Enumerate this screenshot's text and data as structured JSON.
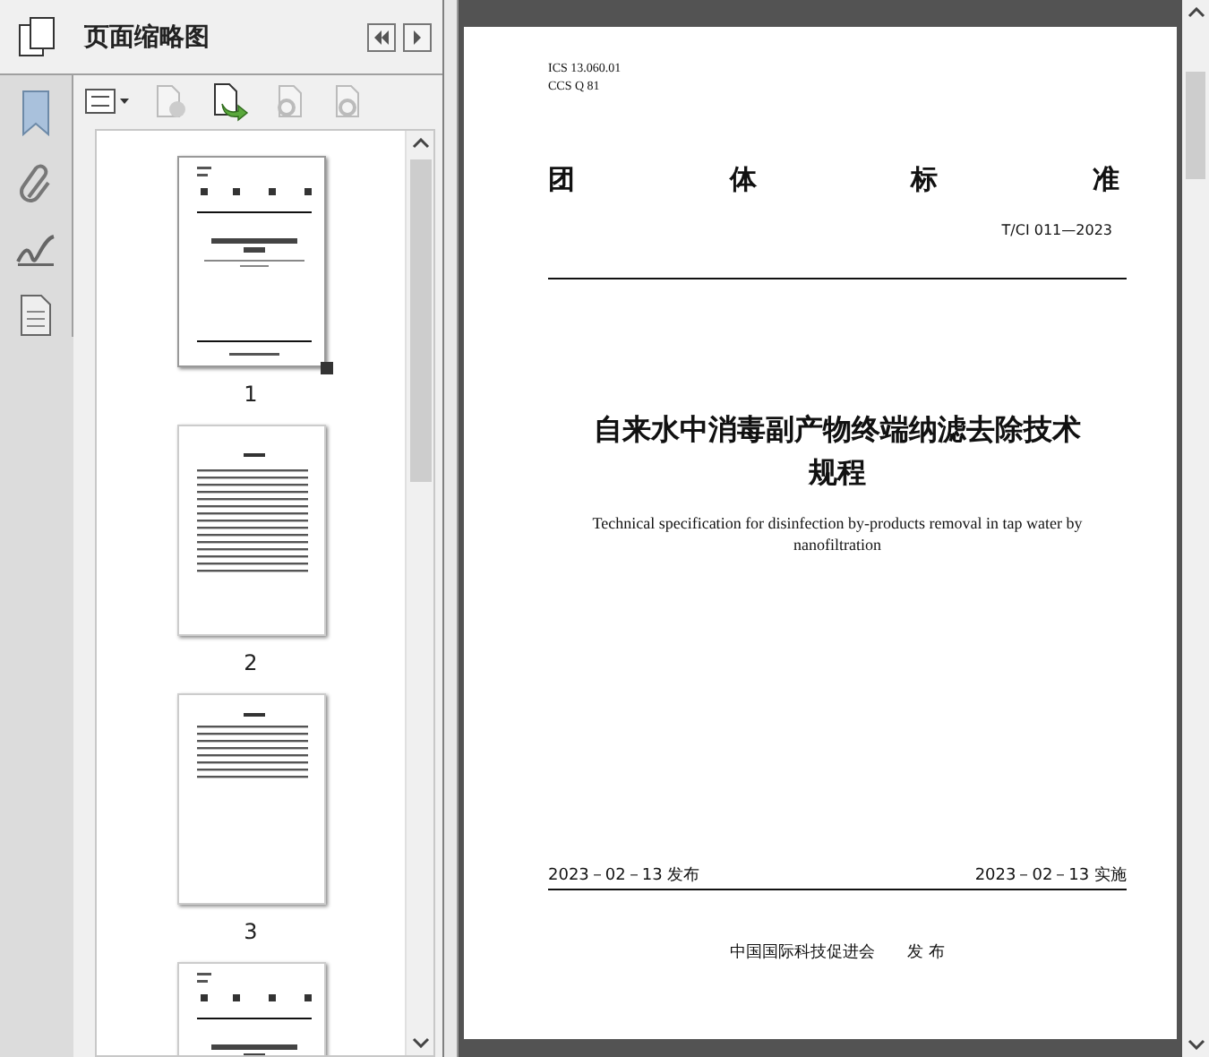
{
  "panel": {
    "title": "页面缩略图"
  },
  "thumbnails": [
    {
      "label": "1",
      "selected": true,
      "kind": "cover"
    },
    {
      "label": "2",
      "selected": false,
      "kind": "contents"
    },
    {
      "label": "3",
      "selected": false,
      "kind": "text"
    },
    {
      "selected": false,
      "kind": "cover"
    }
  ],
  "document": {
    "ics": "ICS  13.060.01",
    "ccs": "CCS  Q 81",
    "heading": [
      "团",
      "体",
      "标",
      "准"
    ],
    "code": "T/CI 011—2023",
    "title_cn": "自来水中消毒副产物终端纳滤去除技术规程",
    "title_en": "Technical specification for disinfection by-products removal in tap water by nanofiltration",
    "issue_date": "2023－02－13 发布",
    "effective_date": "2023－02－13 实施",
    "publisher": "中国国际科技促进会",
    "publisher_suffix": "发 布"
  }
}
